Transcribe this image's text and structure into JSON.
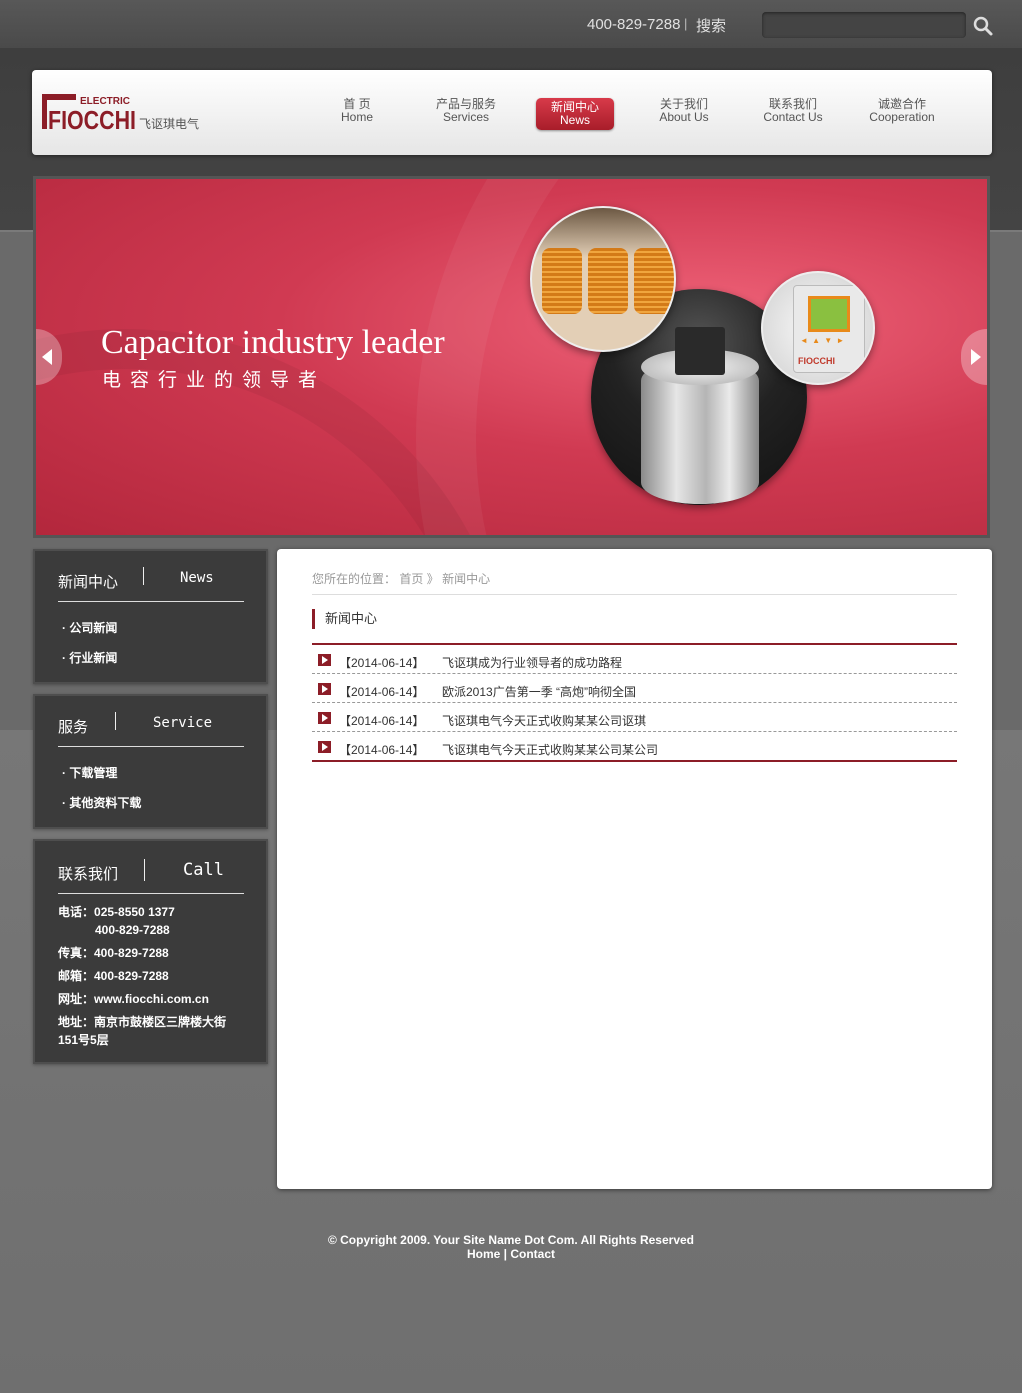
{
  "topbar": {
    "phone": "400-829-7288",
    "separator": "|",
    "search_label": "搜索",
    "search_placeholder": ""
  },
  "brand": {
    "logo_small": "ELECTRIC",
    "logo_main": "FIOCCHI",
    "logo_cn": "飞讴琪电气",
    "color": "#8c1d27"
  },
  "nav": [
    {
      "cn": "首 页",
      "en": "Home"
    },
    {
      "cn": "产品与服务",
      "en": "Services"
    },
    {
      "cn": "新闻中心",
      "en": "News",
      "active": true
    },
    {
      "cn": "关于我们",
      "en": "About Us"
    },
    {
      "cn": "联系我们",
      "en": "Contact Us"
    },
    {
      "cn": "诚邀合作",
      "en": "Cooperation"
    }
  ],
  "banner": {
    "title": "Capacitor industry leader",
    "subtitle": "电容行业的领导者",
    "meter_brand": "FIOCCHI",
    "meter_buttons": "◄ ▲ ▼ ►",
    "bg_color": "#d03a52"
  },
  "sidebar": {
    "news": {
      "cn": "新闻中心",
      "en": "News",
      "links": [
        "· 公司新闻",
        "· 行业新闻"
      ]
    },
    "service": {
      "cn": "服务",
      "en": "Service",
      "links": [
        "· 下载管理",
        "· 其他资料下载"
      ]
    },
    "contact": {
      "cn": "联系我们",
      "en": "Call",
      "tel_label": "电话：",
      "tel1": "025-8550 1377",
      "tel2": "400-829-7288",
      "fax": "传真：400-829-7288",
      "mail": "邮箱：400-829-7288",
      "web": "网址：www.fiocchi.com.cn",
      "addr1": "地址：南京市鼓楼区三牌楼大街",
      "addr2": "151号5层"
    }
  },
  "content": {
    "crumb_prefix": "您所在的位置：",
    "crumb_home": "首页",
    "crumb_sep": "》",
    "crumb_current": "新闻中心",
    "section_title": "新闻中心",
    "news": [
      {
        "date": "【2014-06-14】",
        "title": "飞讴琪成为行业领导者的成功路程"
      },
      {
        "date": "【2014-06-14】",
        "title": "欧派2013广告第一季 “高炮”响彻全国"
      },
      {
        "date": "【2014-06-14】",
        "title": "飞讴琪电气今天正式收购某某公司讴琪"
      },
      {
        "date": "【2014-06-14】",
        "title": "飞讴琪电气今天正式收购某某公司某公司"
      }
    ]
  },
  "footer": {
    "copyright": "© Copyright 2009. Your Site Name Dot Com. All Rights Reserved",
    "home": "Home",
    "sep": " | ",
    "contact": "Contact"
  }
}
